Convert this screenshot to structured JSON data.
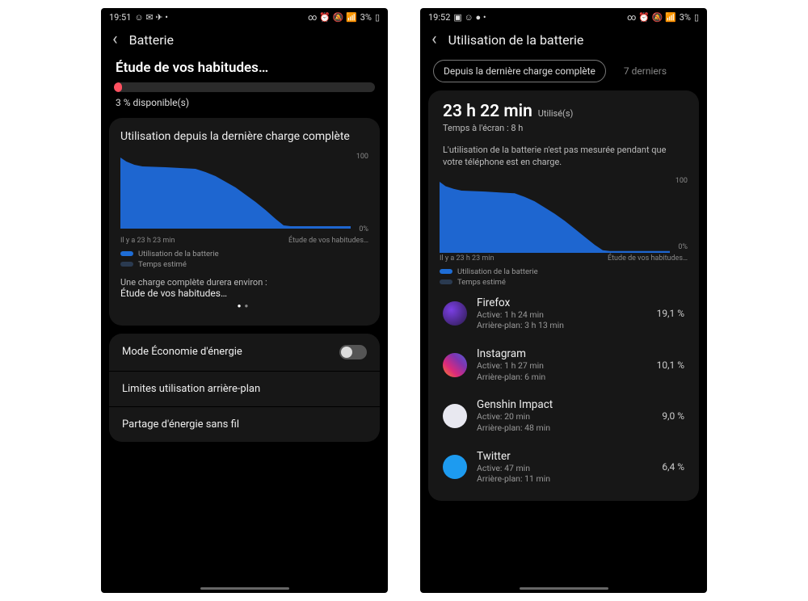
{
  "left": {
    "status": {
      "time": "19:51",
      "battery": "3%"
    },
    "title": "Batterie",
    "heading": "Étude de vos habitudes…",
    "available": "3 % disponible(s)",
    "card_title": "Utilisation depuis la dernière charge complète",
    "axis": {
      "y100": "100",
      "y0": "0%",
      "xl": "Il y a 23 h 23 min",
      "xr": "Étude de vos habitudes…"
    },
    "legend1": "Utilisation de la batterie",
    "legend2": "Temps estimé",
    "estimate_label": "Une charge complète durera environ :",
    "estimate_value": "Étude de vos habitudes…",
    "menu": {
      "eco": "Mode Économie d'énergie",
      "limits": "Limites utilisation arrière-plan",
      "share": "Partage d'énergie sans fil"
    }
  },
  "right": {
    "status": {
      "time": "19:52",
      "battery": "3%"
    },
    "title": "Utilisation de la batterie",
    "chip_active": "Depuis la dernière charge complète",
    "chip_other": "7 derniers",
    "used_time": "23 h 22 min",
    "used_suffix": "Utilisé(s)",
    "screen_on": "Temps à l'écran : 8 h",
    "note": "L'utilisation de la batterie n'est pas mesurée pendant que votre téléphone est en charge.",
    "axis": {
      "y100": "100",
      "y0": "0%",
      "xl": "Il y a 23 h 23 min",
      "xr": "Étude de vos habitudes…"
    },
    "legend1": "Utilisation de la batterie",
    "legend2": "Temps estimé",
    "apps": [
      {
        "name": "Firefox",
        "active": "Active: 1 h 24 min",
        "bg": "Arrière-plan: 3 h 13 min",
        "pct": "19,1 %",
        "icon": "ic-firefox"
      },
      {
        "name": "Instagram",
        "active": "Active: 1 h 27 min",
        "bg": "Arrière-plan: 6 min",
        "pct": "10,1 %",
        "icon": "ic-instagram"
      },
      {
        "name": "Genshin Impact",
        "active": "Active: 20 min",
        "bg": "Arrière-plan: 48 min",
        "pct": "9,0 %",
        "icon": "ic-genshin"
      },
      {
        "name": "Twitter",
        "active": "Active: 47 min",
        "bg": "Arrière-plan: 11 min",
        "pct": "6,4 %",
        "icon": "ic-twitter"
      }
    ]
  },
  "chart_data": {
    "type": "area",
    "title": "Utilisation de la batterie",
    "xlabel": "Il y a 23 h 23 min",
    "ylabel": "%",
    "ylim": [
      0,
      100
    ],
    "x": [
      0,
      1,
      2,
      3,
      4,
      5,
      6,
      7,
      8,
      9,
      10,
      11,
      12,
      13,
      14,
      15,
      16,
      17,
      18,
      19,
      20,
      21,
      22,
      23
    ],
    "series": [
      {
        "name": "Utilisation de la batterie",
        "values": [
          100,
          94,
          90,
          88,
          87,
          86,
          85,
          85,
          84,
          80,
          74,
          66,
          58,
          48,
          38,
          26,
          14,
          5,
          3,
          3,
          3,
          3,
          3,
          3
        ]
      }
    ]
  }
}
